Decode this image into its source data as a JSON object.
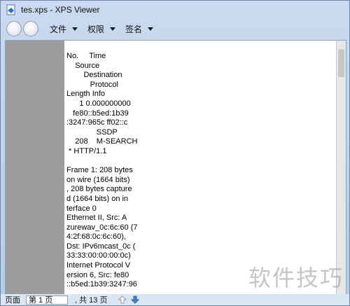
{
  "window": {
    "title": "tes.xps - XPS Viewer"
  },
  "toolbar": {
    "menus": [
      {
        "label": "文件"
      },
      {
        "label": "权限"
      },
      {
        "label": "签名"
      }
    ]
  },
  "document": {
    "lines": [
      "No.     Time",
      "    Source",
      "        Destination",
      "           Protocol",
      "Length Info",
      "      1 0.000000000",
      "   fe80::b5ed:1b39",
      ":3247:965c ff02::c",
      "              SSDP",
      "    208    M-SEARCH",
      " * HTTP/1.1",
      "",
      "Frame 1: 208 bytes",
      "on wire (1664 bits)",
      ", 208 bytes capture",
      "d (1664 bits) on in",
      "terface 0",
      "Ethernet II, Src: A",
      "zurewav_0c:6c:60 (7",
      "4:2f:68:0c:6c:60),",
      "Dst: IPv6mcast_0c (",
      "33:33:00:00:00:0c)",
      "Internet Protocol V",
      "ersion 6, Src: fe80",
      "::b5ed:1b39:3247:96"
    ]
  },
  "statusbar": {
    "page_label": "页面",
    "page_value": "第 1 页",
    "total": ", 共 13 页"
  },
  "watermark": "软件技巧",
  "icons": {
    "app": "xps-document-icon",
    "up": "arrow-up-icon",
    "down": "arrow-down-icon"
  }
}
